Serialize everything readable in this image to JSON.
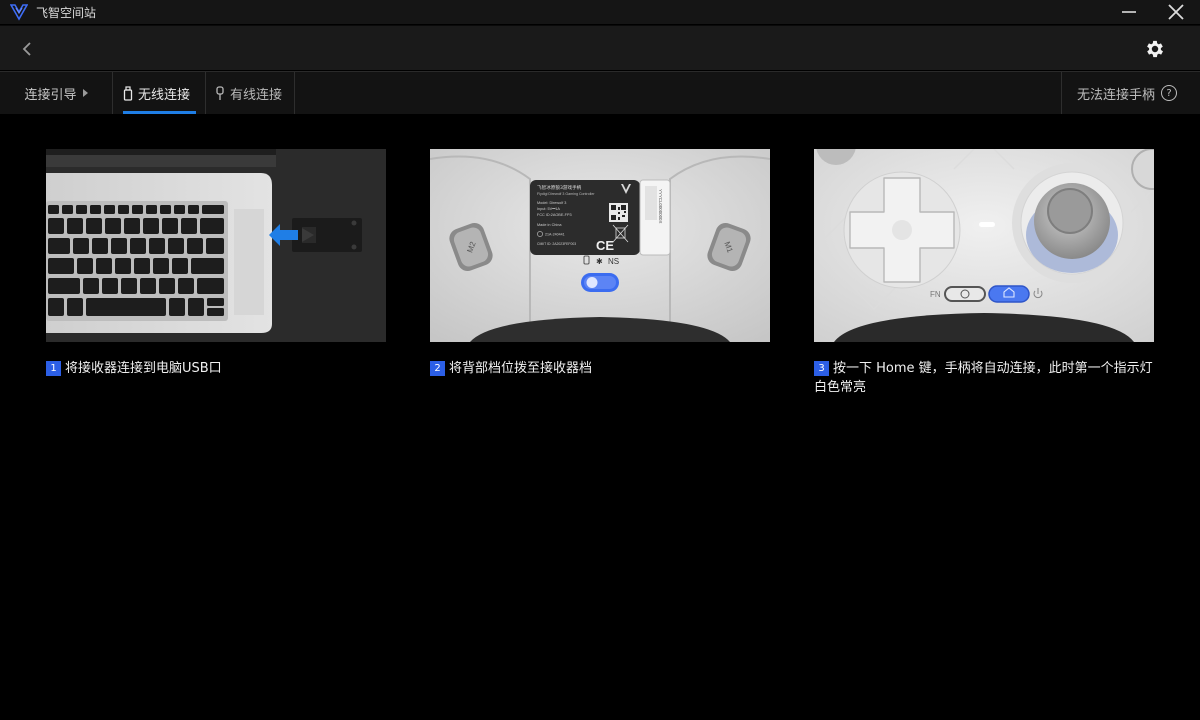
{
  "app": {
    "title": "飞智空间站"
  },
  "tabs": {
    "guide_label": "连接引导",
    "wireless_label": "无线连接",
    "wired_label": "有线连接",
    "help_label": "无法连接手柄",
    "help_glyph": "?"
  },
  "steps": [
    {
      "number": "1",
      "text": "将接收器连接到电脑USB口"
    },
    {
      "number": "2",
      "text": "将背部档位拨至接收器档"
    },
    {
      "number": "3",
      "text": "按一下 Home 键，手柄将自动连接，此时第一个指示灯白色常亮"
    }
  ],
  "controller_label": {
    "brand_line": "飞智冰原狼3游戏手柄",
    "model_line": "Flydigi Direwolf 3 Gaming Controller",
    "model": "Model: Direwolf 3",
    "input": "Input: 5V⎓1A",
    "fcc": "FCC ID:2AOBE-FP3",
    "made_in": "Made in China",
    "serial": "21A-240441",
    "cmiit": "CMIIT ID: 2A2023FEF003",
    "ce": "CE",
    "mode_ns": "NS",
    "side_code": "YYYCL0000000X",
    "m2": "M2",
    "m1": "M1",
    "fn": "FN"
  },
  "colors": {
    "accent": "#1f7ee6",
    "step_badge": "#2c5fe6",
    "switch_blue": "#3b6cf0"
  },
  "icons": {
    "logo": "flydigi-logo",
    "minimize": "minimize-icon",
    "close": "close-icon",
    "back": "back-arrow-icon",
    "settings": "gear-icon",
    "wireless": "usb-receiver-icon",
    "wired": "cable-icon",
    "help": "question-circle-icon"
  }
}
